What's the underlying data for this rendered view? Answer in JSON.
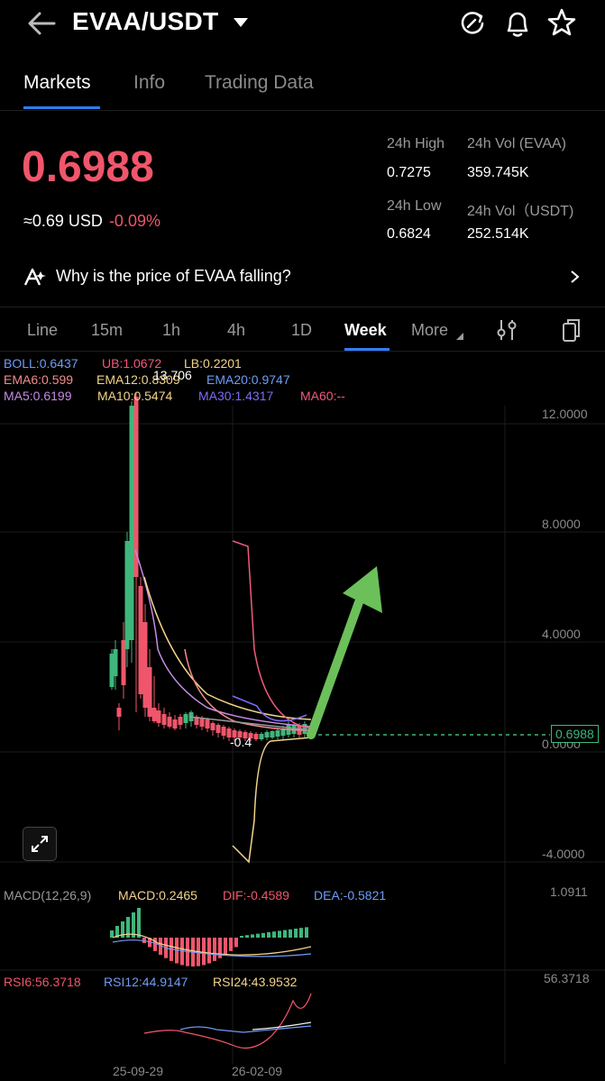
{
  "header": {
    "pair": "EVAA/USDT"
  },
  "tabs": [
    "Markets",
    "Info",
    "Trading Data"
  ],
  "ticker": {
    "price": "0.6988",
    "usd": "≈0.69 USD",
    "change": "-0.09%",
    "high_label": "24h High",
    "high": "0.7275",
    "vol_base_label": "24h Vol (EVAA)",
    "vol_base": "359.745K",
    "low_label": "24h Low",
    "low": "0.6824",
    "vol_quote_label": "24h Vol（USDT)",
    "vol_quote": "252.514K"
  },
  "insight": "Why is the price of EVAA falling?",
  "intervals": [
    "Line",
    "15m",
    "1h",
    "4h",
    "1D",
    "Week",
    "More"
  ],
  "indicators": {
    "boll": "BOLL:0.6437",
    "ub": "UB:1.0672",
    "lb": "LB:0.2201",
    "ema6": "EMA6:0.599",
    "ema12": "EMA12:0.8309",
    "ema20": "EMA20:0.9747",
    "ma5": "MA5:0.6199",
    "ma10": "MA10:0.5474",
    "ma30": "MA30:1.4317",
    "ma60": "MA60:--",
    "high_marker": "13.706",
    "low_marker": "-0.4"
  },
  "price_axis": [
    "12.0000",
    "8.0000",
    "4.0000",
    "0.0000",
    "-4.0000"
  ],
  "last_price_tag": "0.6988",
  "macd": {
    "label": "MACD(12,26,9)",
    "macd": "MACD:0.2465",
    "dif": "DIF:-0.4589",
    "dea": "DEA:-0.5821",
    "axis": "1.0911"
  },
  "rsi": {
    "rsi6": "RSI6:56.3718",
    "rsi12": "RSI12:44.9147",
    "rsi24": "RSI24:43.9532",
    "axis": "56.3718"
  },
  "dates": [
    "25-09-29",
    "26-02-09"
  ],
  "colors": {
    "up": "#3fb67b",
    "down": "#f0566b",
    "accent": "#2f7ef7"
  },
  "chart_data": {
    "type": "candlestick",
    "y_ticks": [
      12,
      8,
      4,
      0,
      -4
    ],
    "x_labels": [
      "25-09-29",
      "26-02-09"
    ],
    "last_price": 0.6988
  }
}
